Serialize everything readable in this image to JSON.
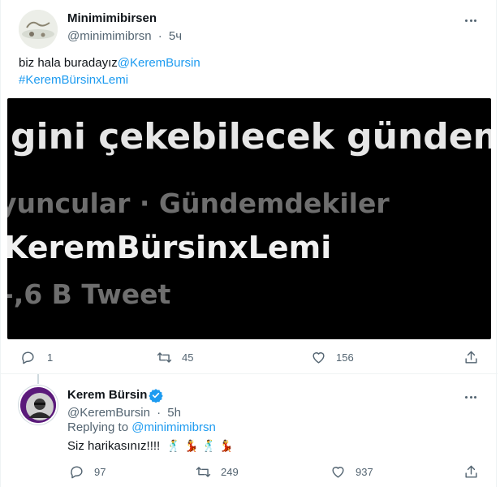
{
  "tweet1": {
    "display_name": "Minimimibirsen",
    "handle": "@minimimibrsn",
    "separator": "·",
    "time": "5ч",
    "text_plain": "biz hala buradayız",
    "mention": "@KeremBursin",
    "hashtag": "#KeremBürsinxLemi",
    "media": {
      "line1": "gini çekebilecek gündemle",
      "line2": "yuncular · Gündemdekiler",
      "line3": "KeremBürsinxLemi",
      "line4": "-,6 B Tweet"
    },
    "actions": {
      "reply_count": "1",
      "retweet_count": "45",
      "like_count": "156"
    }
  },
  "tweet2": {
    "display_name": "Kerem Bürsin",
    "handle": "@KeremBursin",
    "separator": "·",
    "time": "5h",
    "replying_prefix": "Replying to",
    "replying_handle": "@minimimibrsn",
    "text": "Siz harikasınız!!!!",
    "emojis": [
      "🕺",
      "💃",
      "🕺",
      "💃"
    ],
    "actions": {
      "reply_count": "97",
      "retweet_count": "249",
      "like_count": "937"
    }
  },
  "colors": {
    "link": "#1d9bf0",
    "secondary_text": "#536471",
    "verified": "#1d9bf0"
  }
}
